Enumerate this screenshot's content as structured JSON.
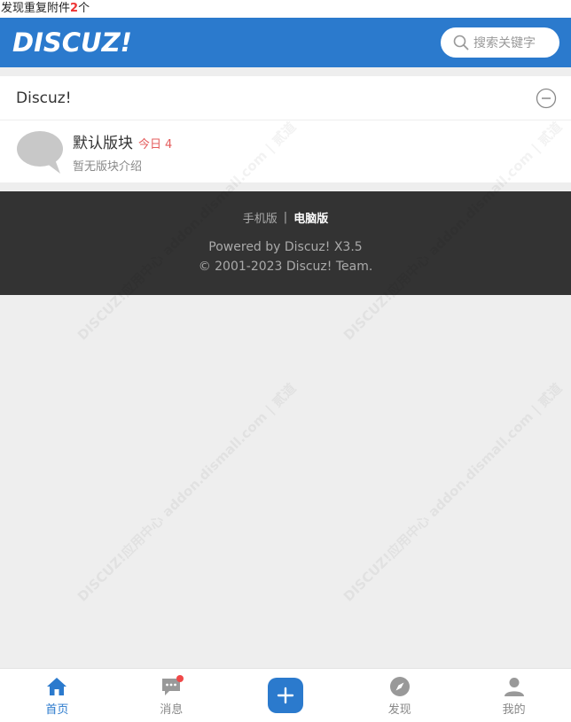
{
  "notice": {
    "text": "发现重复附件",
    "count": "2",
    "suffix": "个"
  },
  "header": {
    "logo": "DISCUZ!",
    "search_placeholder": "搜索关键字"
  },
  "forum_group": {
    "title": "Discuz!",
    "forums": [
      {
        "name": "默认版块",
        "today_label": "今日",
        "today_count": "4",
        "description": "暂无版块介绍"
      }
    ]
  },
  "footer": {
    "mobile_link": "手机版",
    "separator": "|",
    "pc_link": "电脑版",
    "powered": "Powered by Discuz! X3.5",
    "copyright": "© 2001-2023 Discuz! Team."
  },
  "watermark": {
    "text": "DISCUZ!应用中心 addon.dismall.com | 贰道"
  },
  "tabbar": {
    "items": [
      {
        "label": "首页",
        "icon": "home-icon",
        "active": true
      },
      {
        "label": "消息",
        "icon": "message-icon",
        "active": false
      },
      {
        "label": "",
        "icon": "plus-icon",
        "active": false
      },
      {
        "label": "发现",
        "icon": "compass-icon",
        "active": false
      },
      {
        "label": "我的",
        "icon": "user-icon",
        "active": false
      }
    ]
  },
  "colors": {
    "brand": "#2b7acd",
    "today": "#e45c5c",
    "footer_bg": "#333333",
    "page_bg": "#eeeeee"
  }
}
